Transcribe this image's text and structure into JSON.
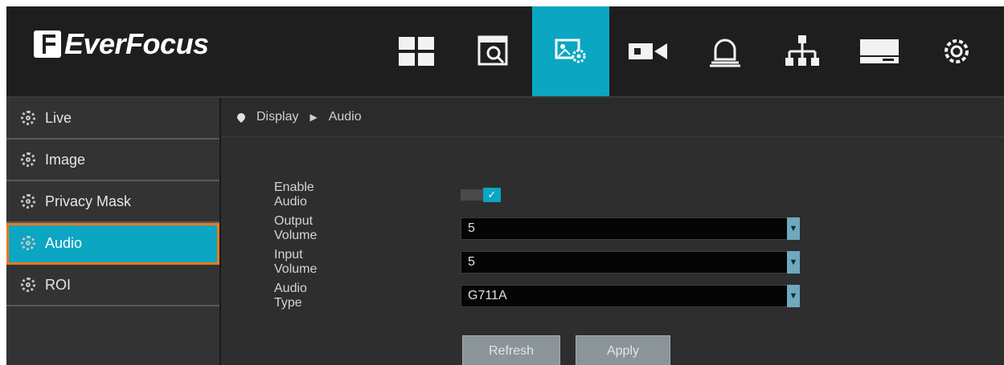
{
  "app": {
    "brand": "EverFocus"
  },
  "nav": [
    {
      "name": "live-view-icon",
      "active": false
    },
    {
      "name": "playback-search-icon",
      "active": false
    },
    {
      "name": "display-settings-icon",
      "active": true
    },
    {
      "name": "camera-icon",
      "active": false
    },
    {
      "name": "alarm-icon",
      "active": false
    },
    {
      "name": "network-icon",
      "active": false
    },
    {
      "name": "storage-icon",
      "active": false
    },
    {
      "name": "settings-gear-icon",
      "active": false
    }
  ],
  "sidebar": {
    "items": [
      {
        "label": "Live",
        "active": false
      },
      {
        "label": "Image",
        "active": false
      },
      {
        "label": "Privacy Mask",
        "active": false
      },
      {
        "label": "Audio",
        "active": true
      },
      {
        "label": "ROI",
        "active": false
      }
    ]
  },
  "breadcrumb": {
    "parent": "Display",
    "current": "Audio"
  },
  "form": {
    "enable_audio": {
      "label": "Enable Audio",
      "checked": true,
      "check_glyph": "✓"
    },
    "output_volume": {
      "label": "Output Volume",
      "value": "5"
    },
    "input_volume": {
      "label": "Input Volume",
      "value": "5"
    },
    "audio_type": {
      "label": "Audio Type",
      "value": "G711A"
    },
    "dropdown_glyph": "▼"
  },
  "buttons": {
    "refresh": "Refresh",
    "apply": "Apply"
  },
  "colors": {
    "accent": "#0aa6c2",
    "highlight": "#e87a1e",
    "background": "#2b2b2b"
  }
}
